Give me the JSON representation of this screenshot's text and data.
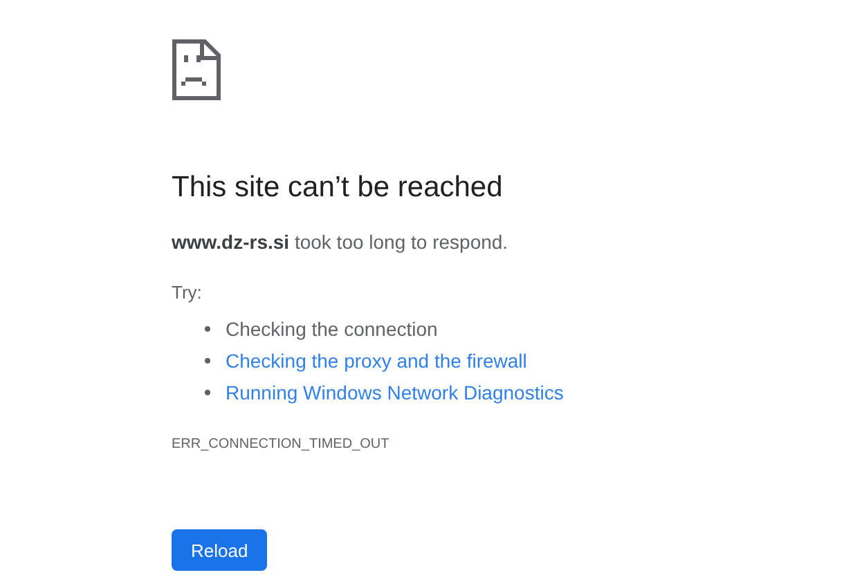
{
  "heading": "This site can’t be reached",
  "description": "**www.dz-rs.si** took too long to respond.",
  "suggestions_label": "Try:",
  "suggestions": [
    {
      "kind": "text",
      "label": "Checking the connection"
    },
    {
      "kind": "link",
      "label": "Checking the proxy and the firewall"
    },
    {
      "kind": "link",
      "label": "Running Windows Network Diagnostics"
    }
  ],
  "error_code": "ERR_CONNECTION_TIMED_OUT",
  "button": "Reload"
}
